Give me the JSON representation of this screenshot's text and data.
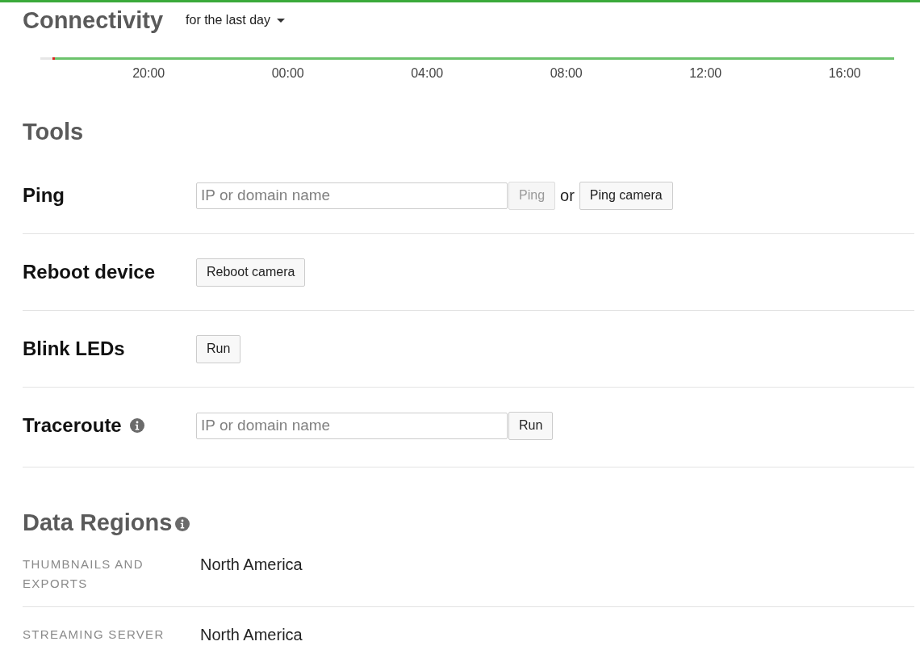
{
  "connectivity": {
    "title": "Connectivity",
    "range": "for the last day",
    "axis_labels": [
      "20:00",
      "00:00",
      "04:00",
      "08:00",
      "12:00",
      "16:00"
    ]
  },
  "tools": {
    "title": "Tools",
    "rows": [
      {
        "label": "Ping",
        "info": false,
        "controls": [
          {
            "kind": "field",
            "placeholder": "IP or domain name"
          },
          {
            "kind": "button",
            "label": "Ping",
            "disabled": true
          },
          {
            "kind": "text",
            "label": "or"
          },
          {
            "kind": "button",
            "label": "Ping camera",
            "disabled": false
          }
        ]
      },
      {
        "label": "Reboot device",
        "info": false,
        "controls": [
          {
            "kind": "button",
            "label": "Reboot camera",
            "disabled": false
          }
        ]
      },
      {
        "label": "Blink LEDs",
        "info": false,
        "controls": [
          {
            "kind": "button",
            "label": "Run",
            "disabled": false
          }
        ]
      },
      {
        "label": "Traceroute",
        "info": true,
        "controls": [
          {
            "kind": "field",
            "placeholder": "IP or domain name"
          },
          {
            "kind": "button",
            "label": "Run",
            "disabled": false
          }
        ]
      }
    ]
  },
  "data_regions": {
    "title": "Data Regions",
    "info": true,
    "rows": [
      {
        "label": "THUMBNAILS AND EXPORTS",
        "value": "North America"
      },
      {
        "label": "STREAMING SERVER",
        "value": "North America"
      }
    ]
  }
}
